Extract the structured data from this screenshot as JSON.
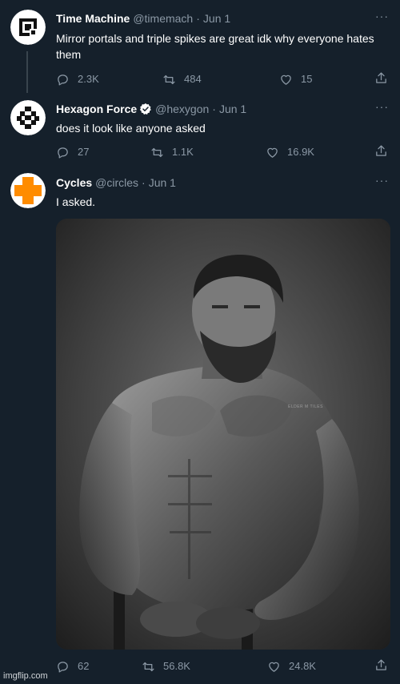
{
  "tweets": [
    {
      "display_name": "Time Machine",
      "handle": "@timemach",
      "dot": "·",
      "date": "Jun 1",
      "more": "···",
      "text": "Mirror portals and triple spikes are great idk why everyone hates them",
      "replies": "2.3K",
      "retweets": "484",
      "likes": "15"
    },
    {
      "display_name": "Hexagon Force",
      "handle": "@hexygon",
      "dot": "·",
      "date": "Jun 1",
      "more": "···",
      "text": "does it look like anyone asked",
      "replies": "27",
      "retweets": "1.1K",
      "likes": "16.9K"
    },
    {
      "display_name": "Cycles",
      "handle": "@circles",
      "dot": "·",
      "date": "Jun 1",
      "more": "···",
      "text": "I asked.",
      "replies": "62",
      "retweets": "56.8K",
      "likes": "24.8K"
    }
  ],
  "media": {
    "photo_credit": "ELDER M TILES"
  },
  "watermark": "imgflip.com",
  "colors": {
    "background": "#15202b",
    "muted": "#8b98a5",
    "verified_badge": "#ffffff",
    "cycles_avatar": "#ff8c00"
  },
  "icons": {
    "reply": "reply-icon",
    "retweet": "retweet-icon",
    "like": "heart-icon",
    "share": "share-icon",
    "more": "more-icon",
    "verified": "verified-badge-icon"
  }
}
